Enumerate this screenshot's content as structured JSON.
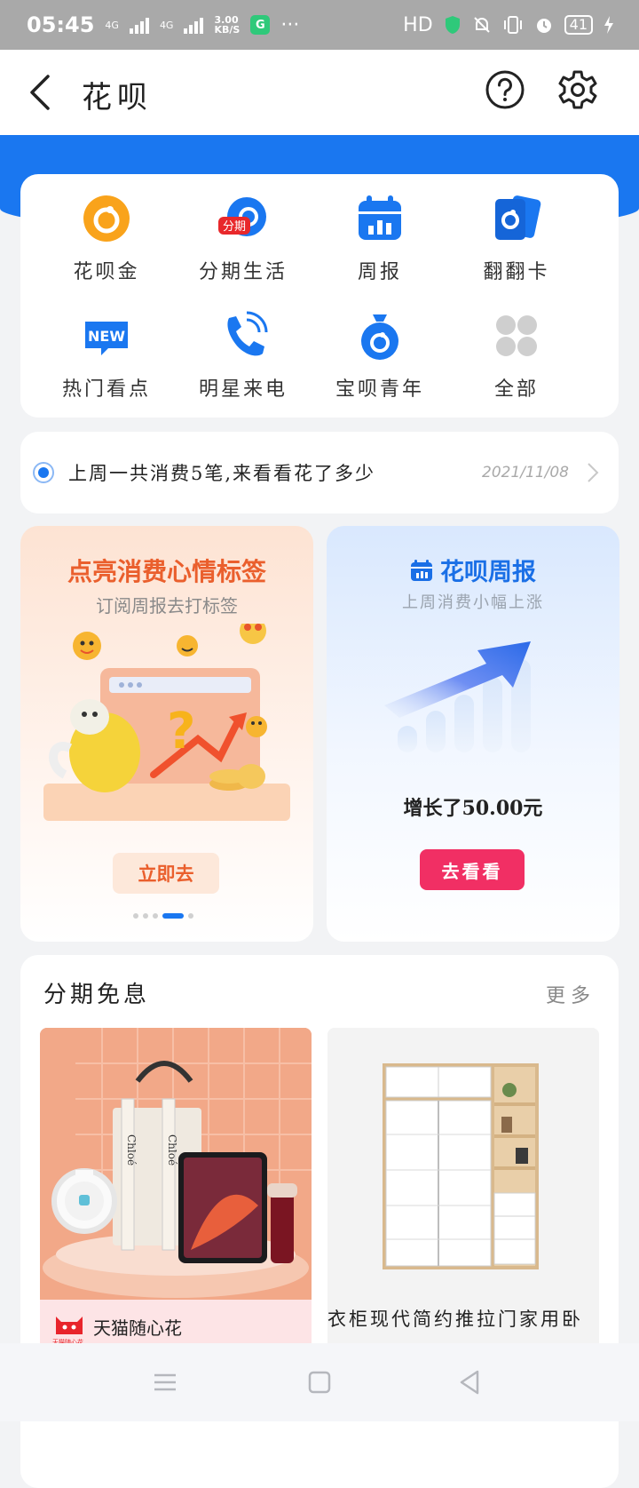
{
  "status_bar": {
    "time": "05:45",
    "net1": "4G",
    "net2": "4G",
    "speed_value": "3.00",
    "speed_unit": "KB/S",
    "hd": "HD",
    "battery": "41",
    "app_badge": "G"
  },
  "header": {
    "title": "花呗"
  },
  "shortcuts": [
    {
      "label": "花呗金",
      "icon": "huabei-gold-icon"
    },
    {
      "label": "分期生活",
      "icon": "installment-life-icon",
      "badge": "分期"
    },
    {
      "label": "周报",
      "icon": "weekly-report-icon"
    },
    {
      "label": "翻翻卡",
      "icon": "flip-card-icon"
    },
    {
      "label": "热门看点",
      "icon": "hot-news-icon",
      "badge": "NEW"
    },
    {
      "label": "明星来电",
      "icon": "phone-call-icon"
    },
    {
      "label": "宝呗青年",
      "icon": "money-bag-icon"
    },
    {
      "label": "全部",
      "icon": "all-grid-icon"
    }
  ],
  "notice": {
    "text": "上周一共消费5笔,来看看花了多少",
    "date": "2021/11/08"
  },
  "promo_left": {
    "title": "点亮消费心情标签",
    "subtitle": "订阅周报去打标签",
    "button": "立即去"
  },
  "promo_right": {
    "title": "花呗周报",
    "subtitle": "上周消费小幅上涨",
    "growth": "增长了50.00元",
    "button": "去看看"
  },
  "installment": {
    "title": "分期免息",
    "more": "更多",
    "tmall_label": "天猫随心花",
    "tmall_logo_text": "天猫随心花",
    "product2_caption": "衣柜现代简约推拉门家用卧",
    "bag_text": "Chloé"
  },
  "colors": {
    "accent": "#1a77f0",
    "orange": "#ea5f2d",
    "pink": "#f12f64"
  }
}
